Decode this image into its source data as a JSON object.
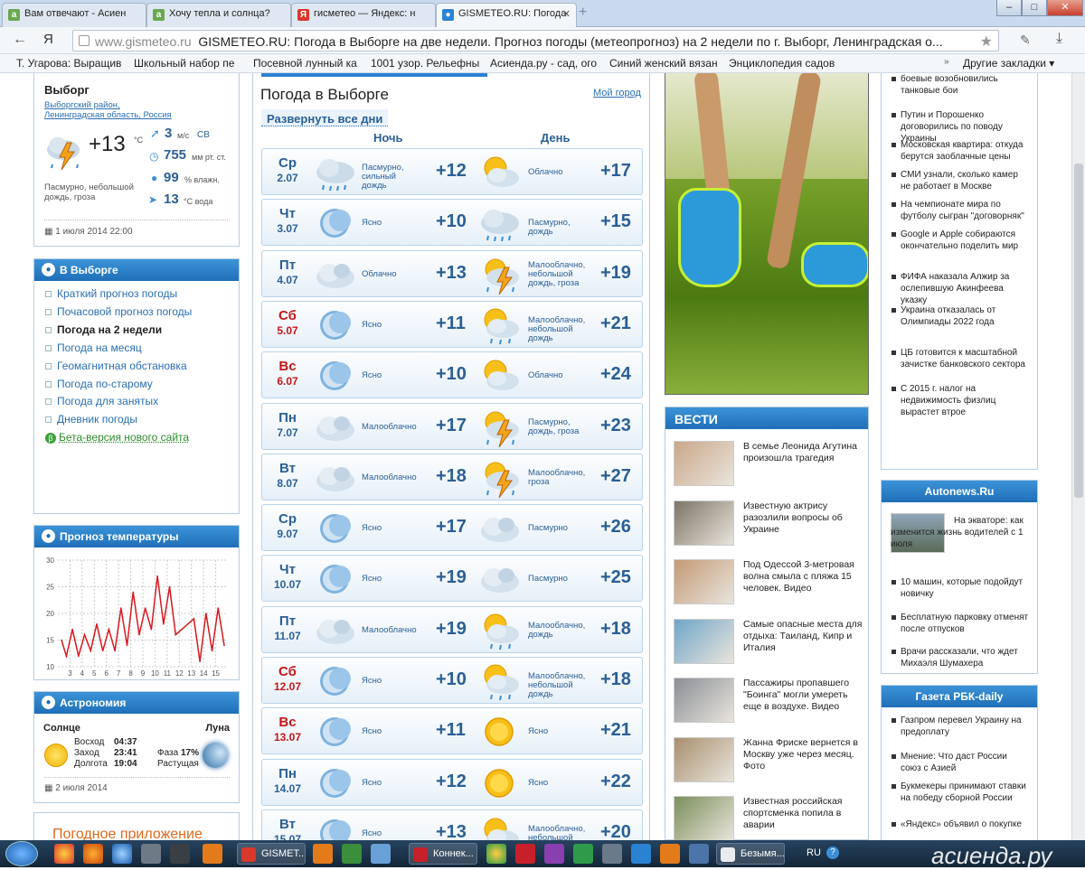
{
  "browser": {
    "tabs": [
      {
        "label": "Вам отвечают - Асиен",
        "icon": "a",
        "color": "#6aa84f"
      },
      {
        "label": "Хочу тепла и солнца?",
        "icon": "a",
        "color": "#6aa84f"
      },
      {
        "label": "гисметео — Яндекс: н",
        "icon": "Я",
        "color": "#d9382c"
      },
      {
        "label": "GISMETEO.RU: Погода",
        "icon": "●",
        "color": "#2a82d2"
      }
    ],
    "new_tab": "+",
    "window_buttons": [
      "–",
      "□",
      "✕"
    ],
    "back": "←",
    "yandex_btn": "Я",
    "url_domain": "www.gismeteo.ru",
    "url_title": "GISMETEO.RU: Погода в Выборге на две недели. Прогноз погоды (метеопрогноз) на 2 недели по г. Выборг, Ленинградская о...",
    "bookmarks": [
      "Т. Угарова: Выращив",
      "Школьный набор пе",
      "Посевной лунный ка",
      "1001 узор. Рельефны",
      "Асиенда.ру - сад, ого",
      "Синий женский вязан",
      "Энциклопедия садов"
    ],
    "other_bookmarks": "Другие закладки ▾"
  },
  "city": {
    "name": "Выборг",
    "path": [
      "Выборгский район,",
      "Ленинградская область,",
      "Россия"
    ],
    "temp": "+13",
    "deg": "°C",
    "wind": "3",
    "wind_unit": "м/с",
    "wind_dir": "СВ",
    "pressure": "755",
    "pressure_unit": "мм рт. ст.",
    "humidity": "99",
    "humidity_unit": "% влажн.",
    "water": "13",
    "water_unit": "°C вода",
    "desc": "Пасмурно, небольшой дождь, гроза",
    "date": "1 июля 2014 22:00"
  },
  "nav": {
    "title": "В Выборге",
    "items": [
      "Краткий прогноз погоды",
      "Почасовой прогноз погоды",
      "Погода на 2 недели",
      "Погода на месяц",
      "Геомагнитная обстановка",
      "Погода по-старому",
      "Погода для занятых",
      "Дневник погоды"
    ],
    "beta": "Бета-версия нового сайта"
  },
  "temp_forecast": {
    "title": "Прогноз температуры",
    "chart_data": {
      "type": "line",
      "title": "",
      "x_ticks": [
        "3",
        "4",
        "5",
        "6",
        "7",
        "8",
        "9",
        "10",
        "11",
        "12",
        "13",
        "14",
        "15"
      ],
      "y_ticks": [
        "10",
        "15",
        "20",
        "25",
        "30"
      ],
      "ylim": [
        10,
        30
      ],
      "xlim": [
        2,
        16
      ],
      "series": [
        {
          "color": "#d71920",
          "x": [
            2.3,
            2.7,
            3.2,
            3.7,
            4.2,
            4.7,
            5.2,
            5.7,
            6.2,
            6.7,
            7.2,
            7.7,
            8.2,
            8.7,
            9.2,
            9.7,
            10.2,
            10.7,
            11.2,
            11.7,
            12.2,
            12.7,
            13.2,
            13.7,
            14.2,
            14.7,
            15.2,
            15.7
          ],
          "values": [
            15,
            12,
            17,
            12,
            16,
            13,
            18,
            13,
            17,
            13,
            21,
            14,
            24,
            16,
            21,
            17,
            27,
            18,
            25,
            16,
            17,
            18,
            19,
            11,
            20,
            13,
            21,
            14
          ]
        }
      ]
    }
  },
  "astro": {
    "title": "Астрономия",
    "sun": "Солнце",
    "moon": "Луна",
    "rise_l": "Восход",
    "rise": "04:37",
    "set_l": "Заход",
    "set": "23:41",
    "len_l": "Долгота",
    "len": "19:04",
    "phase_l": "Фаза",
    "phase": "17%",
    "grow": "Растущая",
    "date": "2 июля 2014"
  },
  "app_promo": "Погодное приложение",
  "forecast": {
    "title": "Погода в Выборге",
    "my_city": "Мой город",
    "expand": "Развернуть все дни",
    "night": "Ночь",
    "day": "День",
    "days": [
      {
        "dow": "Ср",
        "date": "2.07",
        "we": false,
        "ni": "rain",
        "nd": "Пасмурно, сильный дождь",
        "nt": "+12",
        "di": "suncloud",
        "dd": "Облачно",
        "dt": "+17"
      },
      {
        "dow": "Чт",
        "date": "3.07",
        "we": false,
        "ni": "moon",
        "nd": "Ясно",
        "nt": "+10",
        "di": "rain",
        "dd": "Пасмурно, дождь",
        "dt": "+15"
      },
      {
        "dow": "Пт",
        "date": "4.07",
        "we": false,
        "ni": "cloud",
        "nd": "Облачно",
        "nt": "+13",
        "di": "storm",
        "dd": "Малооблачно, небольшой дождь, гроза",
        "dt": "+19"
      },
      {
        "dow": "Сб",
        "date": "5.07",
        "we": true,
        "ni": "moon",
        "nd": "Ясно",
        "nt": "+11",
        "di": "sunrain",
        "dd": "Малооблачно, небольшой дождь",
        "dt": "+21"
      },
      {
        "dow": "Вс",
        "date": "6.07",
        "we": true,
        "ni": "moon",
        "nd": "Ясно",
        "nt": "+10",
        "di": "suncloud",
        "dd": "Облачно",
        "dt": "+24"
      },
      {
        "dow": "Пн",
        "date": "7.07",
        "we": false,
        "ni": "cloud",
        "nd": "Малооблачно",
        "nt": "+17",
        "di": "storm",
        "dd": "Пасмурно, дождь, гроза",
        "dt": "+23"
      },
      {
        "dow": "Вт",
        "date": "8.07",
        "we": false,
        "ni": "cloud",
        "nd": "Малооблачно",
        "nt": "+18",
        "di": "storm",
        "dd": "Малооблачно, гроза",
        "dt": "+27"
      },
      {
        "dow": "Ср",
        "date": "9.07",
        "we": false,
        "ni": "moon",
        "nd": "Ясно",
        "nt": "+17",
        "di": "cloud",
        "dd": "Пасмурно",
        "dt": "+26"
      },
      {
        "dow": "Чт",
        "date": "10.07",
        "we": false,
        "ni": "moon",
        "nd": "Ясно",
        "nt": "+19",
        "di": "cloud",
        "dd": "Пасмурно",
        "dt": "+25"
      },
      {
        "dow": "Пт",
        "date": "11.07",
        "we": false,
        "ni": "cloud",
        "nd": "Малооблачно",
        "nt": "+19",
        "di": "sunrain",
        "dd": "Малооблачно, дождь",
        "dt": "+18"
      },
      {
        "dow": "Сб",
        "date": "12.07",
        "we": true,
        "ni": "moon",
        "nd": "Ясно",
        "nt": "+10",
        "di": "sunrain",
        "dd": "Малооблачно, небольшой дождь",
        "dt": "+18"
      },
      {
        "dow": "Вс",
        "date": "13.07",
        "we": true,
        "ni": "moon",
        "nd": "Ясно",
        "nt": "+11",
        "di": "sun",
        "dd": "Ясно",
        "dt": "+21"
      },
      {
        "dow": "Пн",
        "date": "14.07",
        "we": false,
        "ni": "moon",
        "nd": "Ясно",
        "nt": "+12",
        "di": "sun",
        "dd": "Ясно",
        "dt": "+22"
      },
      {
        "dow": "Вт",
        "date": "15.07",
        "we": false,
        "ni": "moon",
        "nd": "Ясно",
        "nt": "+13",
        "di": "suncloud",
        "dd": "Малооблачно, небольшой дождь",
        "dt": "+20"
      }
    ]
  },
  "vesti": {
    "title": "ВЕСТИ",
    "items": [
      "В семье Леонида Агутина произошла трагедия",
      "Известную актрису разозлили вопросы об Украине",
      "Под Одессой 3-метровая волна смыла с пляжа 15 человек. Видео",
      "Самые опасные места для отдыха: Таиланд, Кипр и Италия",
      "Пассажиры пропавшего \"Боинга\" могли умереть еще в воздухе. Видео",
      "Жанна Фриске вернется в Москву уже через месяц. Фото",
      "Известная российская спортсменка попила в аварии"
    ]
  },
  "news_top": [
    "Путин и Порошенко договорились по поводу Украины",
    "Московская квартира: откуда берутся заоблачные цены",
    "СМИ узнали, сколько камер не работает в Москве",
    "На чемпионате мира по футболу сыгран \"договорняк\"",
    "Google и Apple собираются окончательно поделить мир",
    "ФИФА наказала Алжир за ослепившую Акинфеева указку",
    "Украина отказалась от Олимпиады 2022 года",
    "ЦБ готовится к масштабной зачистке банковского сектора",
    "С 2015 г. налог на недвижимость физлиц вырастет втрое"
  ],
  "news_top_cut": "боевые возобновились танковые бои",
  "autonews": {
    "title": "Autonews.Ru",
    "lead": "На экваторе: как изменится жизнь водителей с 1 июля",
    "items": [
      "10 машин, которые подойдут новичку",
      "Бесплатную парковку отменят после отпусков",
      "Врачи рассказали, что ждет Михаэля Шумахера"
    ]
  },
  "rbk": {
    "title": "Газета РБК-daily",
    "items": [
      "Газпром перевел Украину на предоплату",
      "Мнение: Что даст России союз с Азией",
      "Букмекеры принимают ставки на победу сборной России",
      "«Яндекс» объявил о покупке"
    ]
  },
  "taskbar": {
    "items": [
      "GISMET...",
      "Коннек...",
      "Безымя..."
    ],
    "lang": "RU",
    "watermark": "асиенда.ру"
  }
}
